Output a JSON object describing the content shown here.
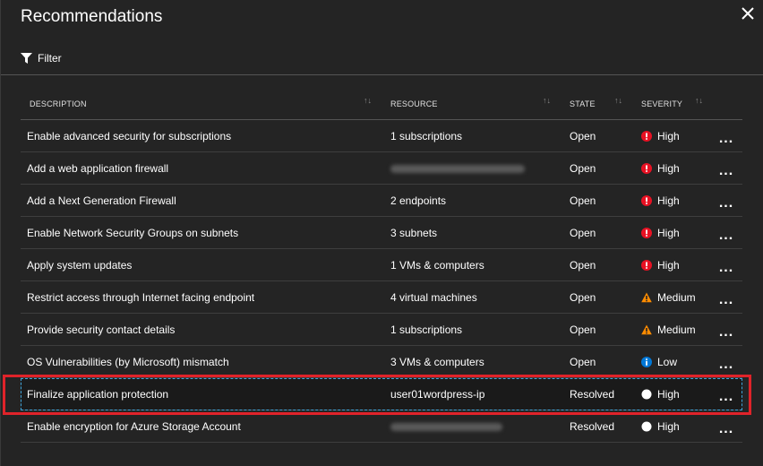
{
  "title": "Recommendations",
  "filter_label": "Filter",
  "columns": {
    "description": "DESCRIPTION",
    "resource": "RESOURCE",
    "state": "STATE",
    "severity": "SEVERITY"
  },
  "rows": [
    {
      "description": "Enable advanced security for subscriptions",
      "resource": "1 subscriptions",
      "state": "Open",
      "severity": "High",
      "severity_icon": "error-icon"
    },
    {
      "description": "Add a web application firewall",
      "resource": "",
      "state": "Open",
      "severity": "High",
      "severity_icon": "error-icon"
    },
    {
      "description": "Add a Next Generation Firewall",
      "resource": "2 endpoints",
      "state": "Open",
      "severity": "High",
      "severity_icon": "error-icon"
    },
    {
      "description": "Enable Network Security Groups on subnets",
      "resource": "3 subnets",
      "state": "Open",
      "severity": "High",
      "severity_icon": "error-icon"
    },
    {
      "description": "Apply system updates",
      "resource": "1 VMs & computers",
      "state": "Open",
      "severity": "High",
      "severity_icon": "error-icon"
    },
    {
      "description": "Restrict access through Internet facing endpoint",
      "resource": "4 virtual machines",
      "state": "Open",
      "severity": "Medium",
      "severity_icon": "warning-icon"
    },
    {
      "description": "Provide security contact details",
      "resource": "1 subscriptions",
      "state": "Open",
      "severity": "Medium",
      "severity_icon": "warning-icon"
    },
    {
      "description": "OS Vulnerabilities (by Microsoft) mismatch",
      "resource": "3 VMs & computers",
      "state": "Open",
      "severity": "Low",
      "severity_icon": "info-icon"
    },
    {
      "description": "Finalize application protection",
      "resource": "user01wordpress-ip",
      "state": "Resolved",
      "severity": "High",
      "severity_icon": "resolved-icon"
    },
    {
      "description": "Enable encryption for Azure Storage Account",
      "resource": "",
      "state": "Resolved",
      "severity": "High",
      "severity_icon": "resolved-icon"
    }
  ],
  "more_label": "...",
  "colors": {
    "panel_bg": "#242424",
    "high": "#e81123",
    "medium": "#ff8c00",
    "low": "#0078d7",
    "resolved": "#ffffff",
    "highlight": "#e0232a",
    "selection": "#3fa3d8"
  }
}
